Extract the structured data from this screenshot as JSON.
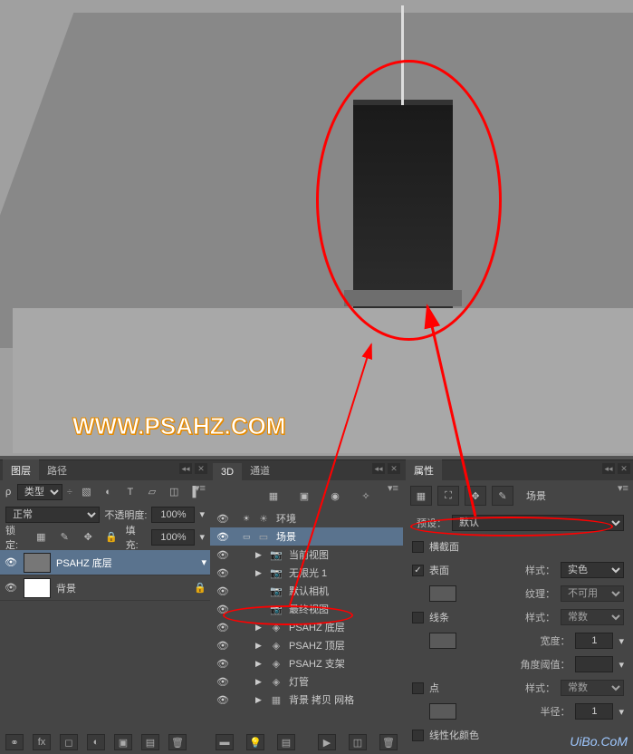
{
  "watermark": "WWW.PSAHZ.COM",
  "footer_mark": "UiBo.CoM",
  "layers_panel": {
    "tabs": [
      "图层",
      "路径"
    ],
    "filter_label": "类型",
    "blend_mode": "正常",
    "opacity_label": "不透明度:",
    "opacity_value": "100%",
    "lock_label": "锁定:",
    "fill_label": "填充:",
    "fill_value": "100%",
    "items": [
      {
        "name": "PSAHZ 底层",
        "selected": true
      },
      {
        "name": "背景",
        "locked": true
      }
    ]
  },
  "panel3d": {
    "tabs": [
      "3D",
      "通道"
    ],
    "items": [
      {
        "icon": "☀",
        "label": "环境",
        "depth": 0
      },
      {
        "icon": "▭",
        "label": "场景",
        "depth": 0,
        "selected": true
      },
      {
        "icon": "▶",
        "sub": "📷",
        "label": "当前视图",
        "depth": 1
      },
      {
        "icon": "▶",
        "sub": "📷",
        "label": "无限光 1",
        "depth": 1
      },
      {
        "icon": "",
        "sub": "📷",
        "label": "默认相机",
        "depth": 1
      },
      {
        "icon": "",
        "sub": "📷",
        "label": "最终视图",
        "depth": 1
      },
      {
        "icon": "▶",
        "sub": "◈",
        "label": "PSAHZ 底层",
        "depth": 1
      },
      {
        "icon": "▶",
        "sub": "◈",
        "label": "PSAHZ 顶层",
        "depth": 1
      },
      {
        "icon": "▶",
        "sub": "◈",
        "label": "PSAHZ 支架",
        "depth": 1
      },
      {
        "icon": "▶",
        "sub": "◈",
        "label": "灯管",
        "depth": 1
      },
      {
        "icon": "▶",
        "sub": "▦",
        "label": "背景 拷贝 网格",
        "depth": 1
      }
    ]
  },
  "properties": {
    "tab": "属性",
    "section_title": "场景",
    "preset_label": "预设：",
    "preset_value": "默认",
    "cross_section": "横截面",
    "surface": "表面",
    "style_label": "样式：",
    "style_solid": "实色",
    "texture_label": "纹理：",
    "texture_value": "不可用",
    "lines": "线条",
    "style_constant": "常数",
    "width_label": "宽度：",
    "width_value": "1",
    "angle_label": "角度阈值：",
    "points": "点",
    "radius_label": "半径：",
    "radius_value": "1",
    "linearize": "线性化颜色"
  }
}
